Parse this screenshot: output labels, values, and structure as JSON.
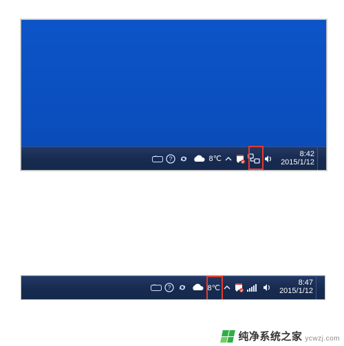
{
  "shot1": {
    "tray": {
      "temperature": "8℃",
      "clock_time": "8:42",
      "clock_date": "2015/1/12"
    },
    "highlight": "network-wired-icon"
  },
  "shot2": {
    "tray": {
      "temperature": "8℃",
      "clock_time": "8:47",
      "clock_date": "2015/1/12"
    },
    "highlight": "network-wifi-icon"
  },
  "icons": {
    "ime": "ime-icon",
    "help": "help-icon",
    "sync": "sync-icon",
    "weather": "weather-cloud-icon",
    "hidden": "show-hidden-icon",
    "flag": "action-center-icon",
    "net_wired": "network-wired-icon",
    "net_wifi": "network-wifi-icon",
    "volume": "volume-icon"
  },
  "watermark": {
    "text": "纯净系统之家",
    "sub": "ycwzj.com"
  }
}
